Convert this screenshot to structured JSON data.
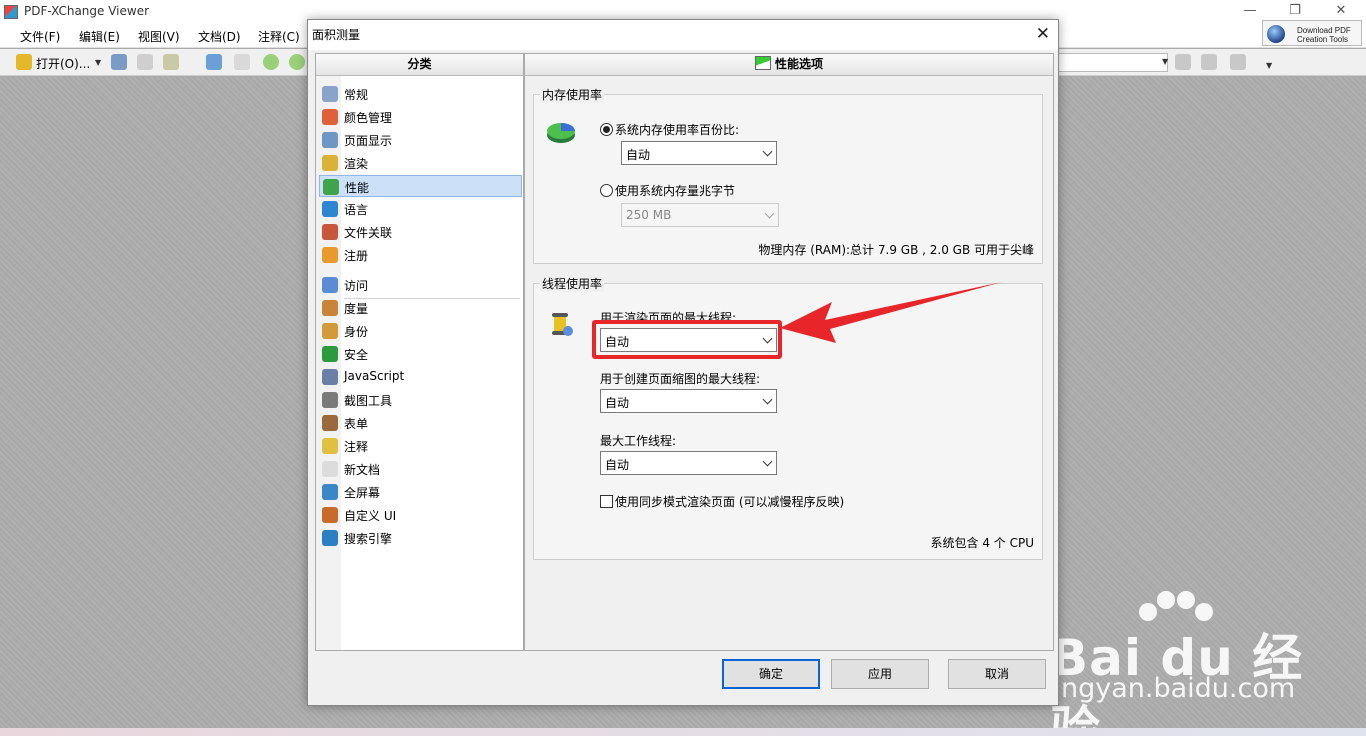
{
  "app": {
    "title": "PDF-XChange Viewer"
  },
  "window_controls": {
    "minimize": "—",
    "restore": "❐",
    "close": "✕"
  },
  "menu": [
    "文件(F)",
    "编辑(E)",
    "视图(V)",
    "文档(D)",
    "注释(C)"
  ],
  "download_button": {
    "line1": "Download PDF",
    "line2": "Creation Tools"
  },
  "toolbar": {
    "open_label": "打开(O)..."
  },
  "dialog": {
    "title": "面积测量",
    "close": "✕",
    "categories_header": "分类",
    "categories": [
      {
        "label": "常规",
        "icon": "gears-icon"
      },
      {
        "label": "颜色管理",
        "icon": "color-circles-icon"
      },
      {
        "label": "页面显示",
        "icon": "page-display-icon"
      },
      {
        "label": "渲染",
        "icon": "brush-icon"
      },
      {
        "label": "性能",
        "icon": "performance-chart-icon",
        "selected": true
      },
      {
        "label": "语言",
        "icon": "globe-icon"
      },
      {
        "label": "文件关联",
        "icon": "file-association-icon"
      },
      {
        "label": "注册",
        "icon": "users-icon"
      },
      {
        "label": "访问",
        "icon": "access-icon"
      },
      {
        "label": "度量",
        "icon": "ruler-icon"
      },
      {
        "label": "身份",
        "icon": "identity-icon"
      },
      {
        "label": "安全",
        "icon": "shield-icon"
      },
      {
        "label": "JavaScript",
        "icon": "javascript-icon"
      },
      {
        "label": "截图工具",
        "icon": "camera-icon"
      },
      {
        "label": "表单",
        "icon": "form-icon"
      },
      {
        "label": "注释",
        "icon": "comment-icon"
      },
      {
        "label": "新文档",
        "icon": "new-document-icon"
      },
      {
        "label": "全屏幕",
        "icon": "fullscreen-icon"
      },
      {
        "label": "自定义 UI",
        "icon": "customize-ui-icon"
      },
      {
        "label": "搜索引擎",
        "icon": "search-engine-icon"
      }
    ],
    "options_header": "性能选项",
    "memory": {
      "title": "内存使用率",
      "radio_percent_label": "系统内存使用率百份比:",
      "radio_percent_checked": true,
      "percent_value": "自动",
      "radio_mb_label": "使用系统内存量兆字节",
      "radio_mb_checked": false,
      "mb_value": "250 MB",
      "ram_info": "物理内存 (RAM):总计 7.9 GB , 2.0 GB 可用于尖峰"
    },
    "threads": {
      "title": "线程使用率",
      "render_label": "用于渲染页面的最大线程:",
      "render_value": "自动",
      "thumb_label": "用于创建页面缩图的最大线程:",
      "thumb_value": "自动",
      "worker_label": "最大工作线程:",
      "worker_value": "自动",
      "sync_label": "使用同步模式渲染页面 (可以减慢程序反映)",
      "sync_checked": false,
      "cpu_info": "系统包含 4 个 CPU"
    },
    "buttons": {
      "ok": "确定",
      "apply": "应用",
      "cancel": "取消"
    }
  },
  "annotation": {
    "highlight_color": "#e8262a"
  },
  "watermark": {
    "logo": "Bai du 经验",
    "url": "jingyan.baidu.com"
  },
  "colors": {
    "accent": "#0a64d2",
    "selection": "#cce0f8"
  }
}
